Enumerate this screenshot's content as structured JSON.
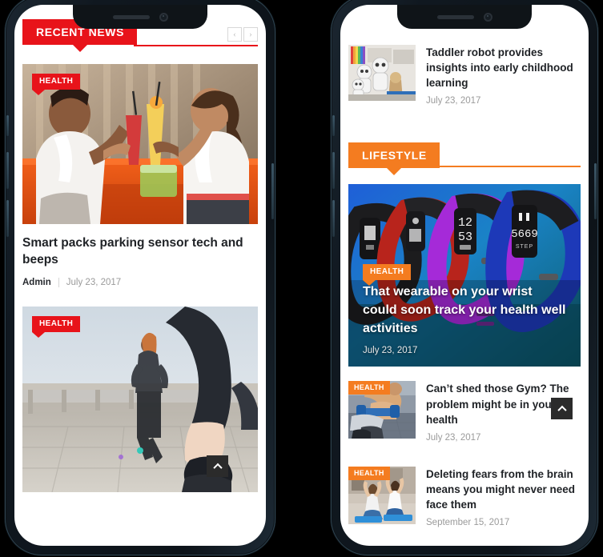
{
  "background_color": "#000000",
  "accent_red": "#e8131a",
  "accent_orange": "#f47c20",
  "left_phone": {
    "section": {
      "label": "RECENT NEWS",
      "color": "#e8131a",
      "prev_label": "‹",
      "next_label": "›"
    },
    "cards": [
      {
        "category": "HEALTH",
        "title": "Smart packs parking sensor tech and beeps",
        "author": "Admin",
        "date": "July 23, 2017",
        "image": "two-people-toasting-smoothies-at-gym-juice-bar"
      },
      {
        "category": "HEALTH",
        "title": "",
        "author": "",
        "date": "",
        "image": "runners-jogging-on-waterfront-boardwalk"
      }
    ],
    "to_top_label": "scroll to top"
  },
  "right_phone": {
    "top_item": {
      "title": "Taddler robot provides insights into early childhood learning",
      "date": "July 23, 2017",
      "image": "white-humanoid-toy-robots-in-classroom"
    },
    "section": {
      "label": "LIFESTYLE",
      "color": "#f47c20"
    },
    "hero": {
      "category": "HEALTH",
      "title": "That wearable on your wrist could soon track your health well activities",
      "date": "July 23, 2017",
      "image": "row-of-colorful-fitness-tracker-bands",
      "device_readouts": [
        "12",
        "53",
        "5669",
        "STEP"
      ]
    },
    "list": [
      {
        "category": "HEALTH",
        "title": "Can’t shed those Gym? The problem might be in your health",
        "date": "July 23, 2017",
        "image": "man-lifting-dumbbells-on-gym-bench"
      },
      {
        "category": "HEALTH",
        "title": "Deleting fears from the brain means you might never need face them",
        "date": "September 15, 2017",
        "image": "two-women-doing-yoga-stretch-on-mats"
      }
    ],
    "to_top_label": "scroll to top"
  }
}
